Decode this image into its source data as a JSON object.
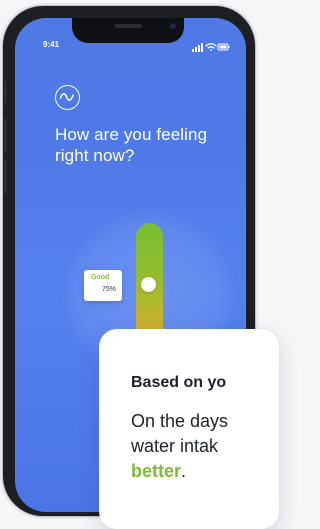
{
  "status_bar": {
    "time": "9:41"
  },
  "colors": {
    "screen_blue": "#4f79e7",
    "good_green": "#79bd32",
    "mood_orange": "#f0a84a",
    "card_white": "#ffffff",
    "text_dark": "#1d2128"
  },
  "icons": {
    "app_logo": "waveform-circle-icon",
    "signal": "cellular-signal-icon",
    "wifi": "wifi-icon",
    "battery": "battery-icon"
  },
  "mood_question": {
    "title": "How are you feeling right now?"
  },
  "mood_slider": {
    "level_label": "Good",
    "level_percent": "75%",
    "level_fraction": 0.75
  },
  "insight_card": {
    "title": "Based on yo",
    "line_1": "On the days",
    "line_2": "water intak",
    "highlight": "better",
    "ending": "."
  }
}
